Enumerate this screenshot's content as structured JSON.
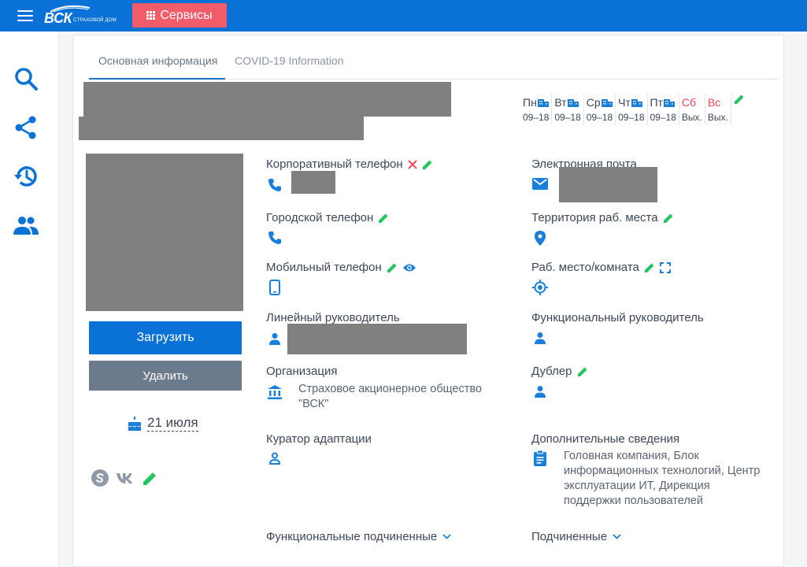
{
  "header": {
    "logo_text": "ВСК",
    "logo_sub": "СТРАХОВОЙ ДОМ",
    "services_label": "Сервисы"
  },
  "tabs": [
    {
      "label": "Основная информация",
      "active": true
    },
    {
      "label": "COVID-19 Information",
      "active": false
    }
  ],
  "schedule": [
    {
      "day": "Пн",
      "hours": "09–18",
      "weekend": false
    },
    {
      "day": "Вт",
      "hours": "09–18",
      "weekend": false
    },
    {
      "day": "Ср",
      "hours": "09–18",
      "weekend": false
    },
    {
      "day": "Чт",
      "hours": "09–18",
      "weekend": false
    },
    {
      "day": "Пт",
      "hours": "09–18",
      "weekend": false
    },
    {
      "day": "Сб",
      "hours": "Вых.",
      "weekend": true
    },
    {
      "day": "Вс",
      "hours": "Вых.",
      "weekend": true
    }
  ],
  "profile": {
    "upload_label": "Загрузить",
    "delete_label": "Удалить",
    "birthday": "21 июля"
  },
  "fields": {
    "corp_phone": "Корпоративный телефон",
    "email": "Электронная почта",
    "city_phone": "Городской телефон",
    "territory": "Территория раб. места",
    "mobile_phone": "Мобильный телефон",
    "workplace": "Раб. место/комната",
    "line_manager": "Линейный руководитель",
    "func_manager": "Функциональный руководитель",
    "organization": "Организация",
    "organization_value": "Страховое акционерное общество \"ВСК\"",
    "backup": "Дублер",
    "curator": "Куратор адаптации",
    "extra_info": "Дополнительные сведения",
    "extra_info_value": "Головная компания, Блок информационных технологий, Центр эксплуатации ИТ, Дирекция поддержки пользователей",
    "func_subordinates": "Функциональные подчиненные",
    "subordinates": "Подчиненные"
  },
  "colors": {
    "primary": "#0a72d6",
    "services": "#f25b6a",
    "edit": "#22c55e",
    "delete_x": "#f04b5a",
    "icon_blue": "#1a7fd8",
    "weekend": "#f04b5a"
  }
}
